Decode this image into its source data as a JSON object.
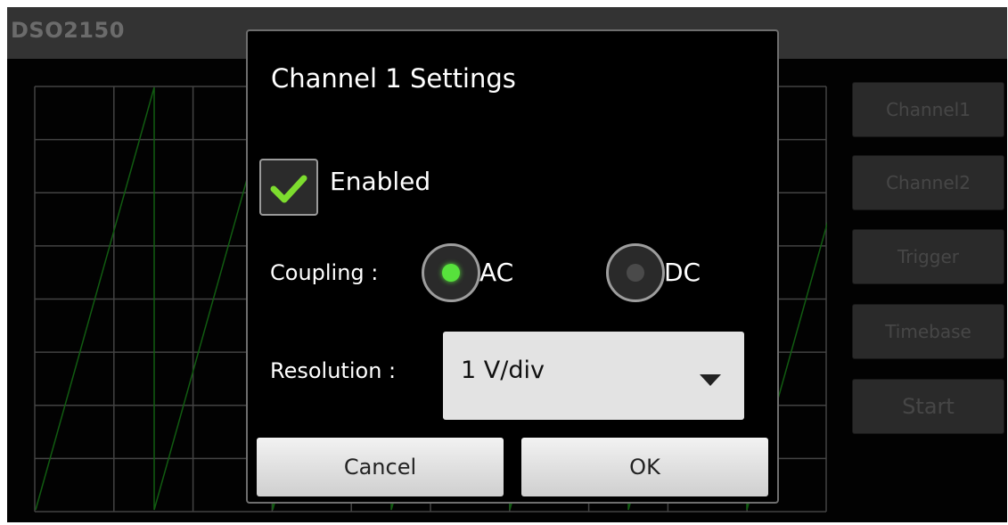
{
  "app": {
    "title": "DSO2150"
  },
  "side_buttons": [
    {
      "label": "Channel1"
    },
    {
      "label": "Channel2"
    },
    {
      "label": "Trigger"
    },
    {
      "label": "Timebase"
    },
    {
      "label": "Start"
    }
  ],
  "dialog": {
    "title": "Channel 1 Settings",
    "enabled": {
      "label": "Enabled",
      "checked": true
    },
    "coupling": {
      "label": "Coupling :",
      "options": [
        "AC",
        "DC"
      ],
      "selected": "AC"
    },
    "resolution": {
      "label": "Resolution :",
      "value": "1 V/div"
    },
    "buttons": {
      "cancel": "Cancel",
      "ok": "OK"
    }
  },
  "colors": {
    "trace": "#1fa81f",
    "grid": "#7a7a7a",
    "radio_selected": "#57e23c",
    "checkmark": "#7ddc2e"
  },
  "icons": {
    "checkbox": "checkmark-icon",
    "dropdown": "caret-down-icon",
    "trigger_marker": "triangle-left-icon"
  }
}
